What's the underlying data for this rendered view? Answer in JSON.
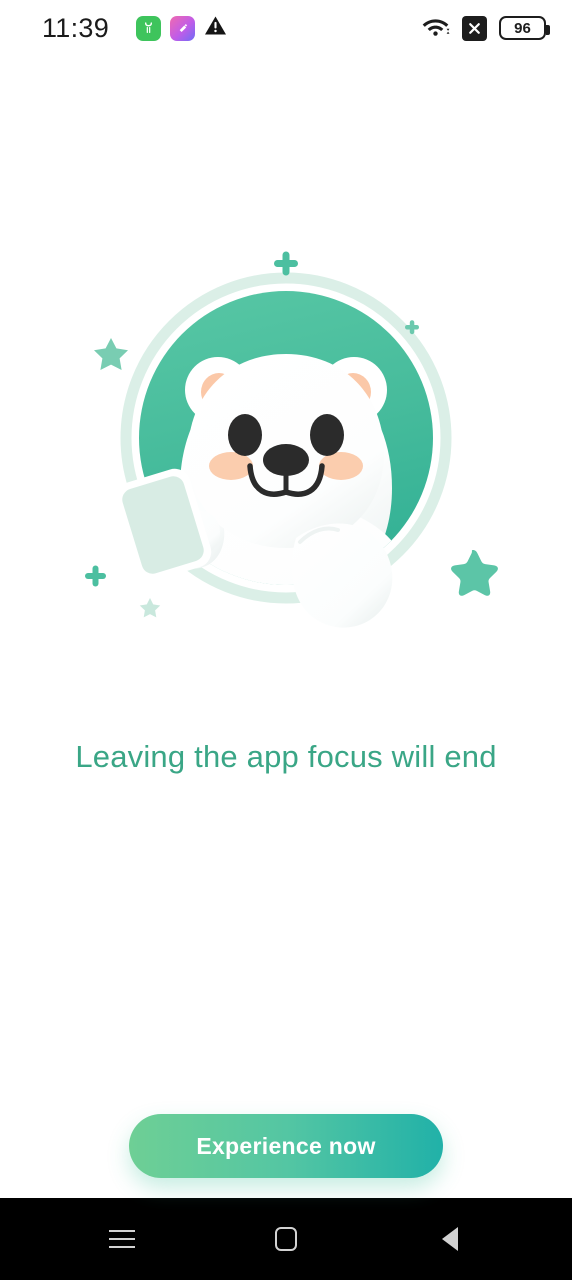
{
  "status_bar": {
    "time": "11:39",
    "left_icons": [
      {
        "name": "clothing-app-icon",
        "glyph": "☂"
      },
      {
        "name": "gallery-app-icon",
        "glyph": "◆"
      },
      {
        "name": "warning-icon",
        "glyph": "⚠"
      }
    ],
    "right_icons": [
      {
        "name": "wifi-icon"
      },
      {
        "name": "no-sim-icon",
        "glyph": "✕"
      }
    ],
    "battery_level": "96"
  },
  "illustration": {
    "name": "polar-bear-with-phone-illustration",
    "circle_fill": "#4cbfa0",
    "circle_ring": "#d9efe7",
    "bear_body": "#ffffff",
    "bear_shadow": "#eef2f1",
    "ear_inner": "#fbc8a8",
    "cheek": "#fbcdae",
    "eye": "#2b2b2b",
    "phone_fill": "#d8ece4",
    "phone_border": "#ffffff",
    "sparkle_color": "#4cbfa0",
    "sparkle_color_light": "#a8dcca",
    "decorations": [
      {
        "name": "plus-sparkle-top",
        "type": "plus"
      },
      {
        "name": "star-sparkle-left",
        "type": "star"
      },
      {
        "name": "plus-sparkle-right-small",
        "type": "plus"
      },
      {
        "name": "plus-sparkle-bottom-left",
        "type": "plus"
      },
      {
        "name": "star-sparkle-bottom-left-faint",
        "type": "star"
      },
      {
        "name": "star-sparkle-right-large",
        "type": "star"
      }
    ]
  },
  "main": {
    "headline": "Leaving the app focus will end",
    "headline_color": "#3aa686"
  },
  "cta": {
    "label": "Experience now",
    "gradient_start": "#6ecf95",
    "gradient_end": "#21b1a8"
  },
  "nav_bar": {
    "recents_label": "Recents",
    "home_label": "Home",
    "back_label": "Back"
  }
}
